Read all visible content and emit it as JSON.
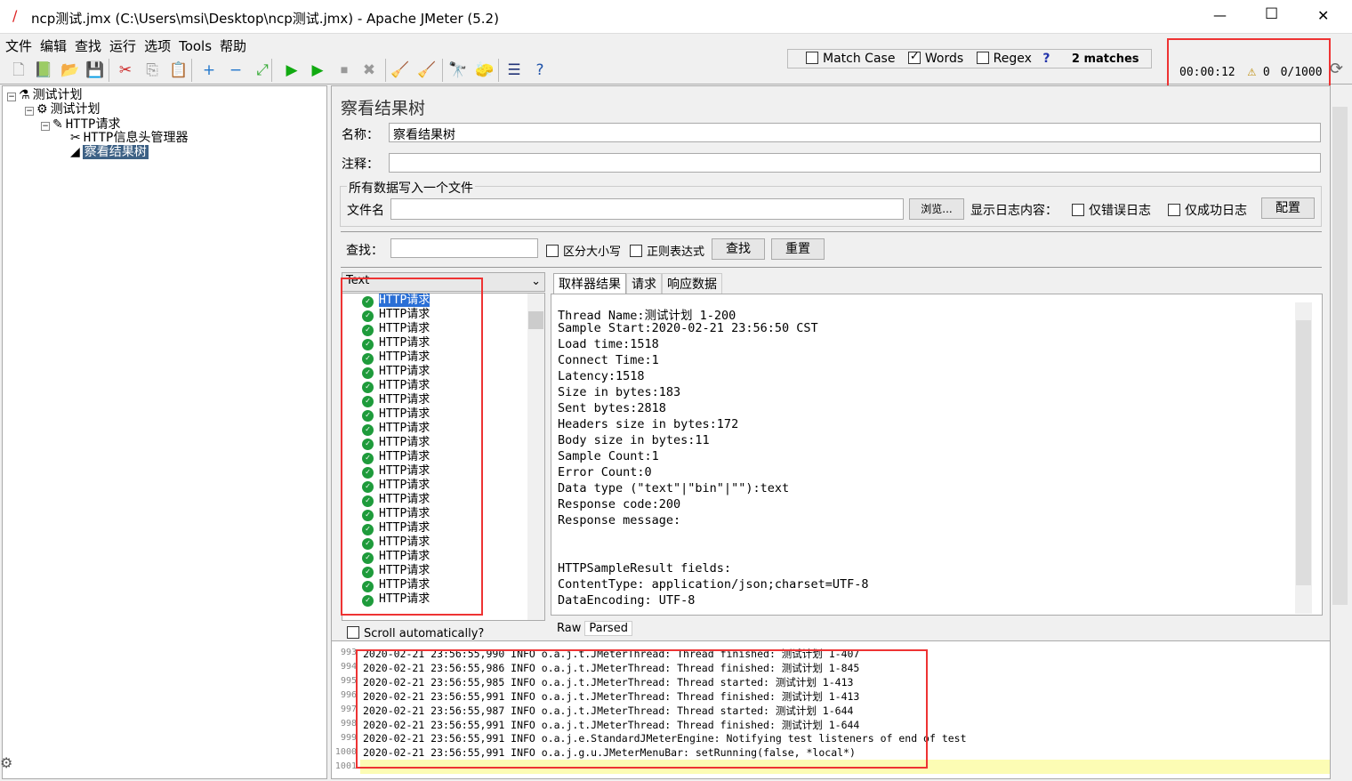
{
  "window": {
    "title": "ncp测试.jmx (C:\\Users\\msi\\Desktop\\ncp测试.jmx) - Apache JMeter (5.2)",
    "minimize": "—",
    "maximize": "☐",
    "close": "✕"
  },
  "menu": [
    "文件",
    "编辑",
    "查找",
    "运行",
    "选项",
    "Tools",
    "帮助"
  ],
  "toolbar_icons": [
    "new-icon",
    "templates-icon",
    "open-icon",
    "save-icon",
    "cut-icon",
    "copy-icon",
    "paste-icon",
    "expand-icon",
    "collapse-icon",
    "toggle-icon",
    "start-icon",
    "start-no-pause-icon",
    "stop-icon",
    "shutdown-icon",
    "clear-icon",
    "clear-all-icon",
    "search-icon",
    "reset-search-icon",
    "function-helper-icon",
    "help-icon"
  ],
  "search_bar": {
    "match_case": "Match Case",
    "match_case_checked": false,
    "words": "Words",
    "words_checked": true,
    "regex": "Regex",
    "regex_checked": false,
    "help": "?",
    "matches": "2 matches"
  },
  "status": {
    "timer": "00:00:12",
    "warnings": "0",
    "threads": "0/1000"
  },
  "tree": [
    {
      "label": "测试计划",
      "icon": "flask-icon"
    },
    {
      "label": "测试计划",
      "icon": "gear-icon"
    },
    {
      "label": "HTTP请求",
      "icon": "pipette-icon"
    },
    {
      "label": "HTTP信息头管理器",
      "icon": "tools-icon"
    },
    {
      "label": "察看结果树",
      "icon": "chart-icon",
      "selected": true
    }
  ],
  "panel": {
    "title": "察看结果树",
    "name_label": "名称：",
    "name_value": "察看结果树",
    "comment_label": "注释：",
    "comment_value": "",
    "file_group": "所有数据写入一个文件",
    "file_label": "文件名",
    "file_value": "",
    "browse": "浏览...",
    "log_label": "显示日志内容：",
    "errors_only": "仅错误日志",
    "success_only": "仅成功日志",
    "configure": "配置",
    "find_label": "查找：",
    "find_value": "",
    "case_sensitive": "区分大小写",
    "regex": "正则表达式",
    "find_button": "查找",
    "reset_button": "重置"
  },
  "results": {
    "renderer": "Text",
    "items": [
      "HTTP请求",
      "HTTP请求",
      "HTTP请求",
      "HTTP请求",
      "HTTP请求",
      "HTTP请求",
      "HTTP请求",
      "HTTP请求",
      "HTTP请求",
      "HTTP请求",
      "HTTP请求",
      "HTTP请求",
      "HTTP请求",
      "HTTP请求",
      "HTTP请求",
      "HTTP请求",
      "HTTP请求",
      "HTTP请求",
      "HTTP请求",
      "HTTP请求",
      "HTTP请求",
      "HTTP请求"
    ],
    "scroll_auto": "Scroll automatically?"
  },
  "detail": {
    "tabs": [
      "取样器结果",
      "请求",
      "响应数据"
    ],
    "lines": [
      "Thread Name:测试计划 1-200",
      "Sample Start:2020-02-21 23:56:50 CST",
      "Load time:1518",
      "Connect Time:1",
      "Latency:1518",
      "Size in bytes:183",
      "Sent bytes:2818",
      "Headers size in bytes:172",
      "Body size in bytes:11",
      "Sample Count:1",
      "Error Count:0",
      "Data type (\"text\"|\"bin\"|\"\"):text",
      "Response code:200",
      "Response message:",
      "",
      "",
      "HTTPSampleResult fields:",
      "ContentType: application/json;charset=UTF-8",
      "DataEncoding: UTF-8"
    ],
    "bottom_tabs": [
      "Raw",
      "Parsed"
    ]
  },
  "log": {
    "lines": [
      {
        "no": "993",
        "text": "2020-02-21 23:56:55,990 INFO o.a.j.t.JMeterThread: Thread finished: 测试计划 1-407"
      },
      {
        "no": "994",
        "text": "2020-02-21 23:56:55,986 INFO o.a.j.t.JMeterThread: Thread finished: 测试计划 1-845"
      },
      {
        "no": "995",
        "text": "2020-02-21 23:56:55,985 INFO o.a.j.t.JMeterThread: Thread started: 测试计划 1-413"
      },
      {
        "no": "996",
        "text": "2020-02-21 23:56:55,991 INFO o.a.j.t.JMeterThread: Thread finished: 测试计划 1-413"
      },
      {
        "no": "997",
        "text": "2020-02-21 23:56:55,987 INFO o.a.j.t.JMeterThread: Thread started: 测试计划 1-644"
      },
      {
        "no": "998",
        "text": "2020-02-21 23:56:55,991 INFO o.a.j.t.JMeterThread: Thread finished: 测试计划 1-644"
      },
      {
        "no": "999",
        "text": "2020-02-21 23:56:55,991 INFO o.a.j.e.StandardJMeterEngine: Notifying test listeners of end of test"
      },
      {
        "no": "1000",
        "text": "2020-02-21 23:56:55,991 INFO o.a.j.g.u.JMeterMenuBar: setRunning(false, *local*)"
      },
      {
        "no": "1001",
        "text": ""
      }
    ]
  },
  "colors": {
    "highlight": "#ee3333",
    "selection": "#3d6185",
    "success": "#1e9b3b",
    "log_current_line": "#fcfcb4"
  }
}
